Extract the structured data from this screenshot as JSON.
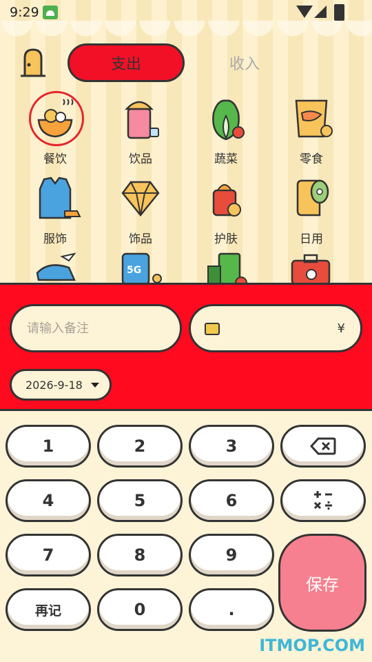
{
  "status_bar": {
    "time": "9:29"
  },
  "header": {
    "tab_expense": "支出",
    "tab_income": "收入"
  },
  "categories": [
    {
      "label": "餐饮",
      "icon": "food-bowl-icon",
      "selected": true
    },
    {
      "label": "饮品",
      "icon": "drink-icon"
    },
    {
      "label": "蔬菜",
      "icon": "vegetable-icon"
    },
    {
      "label": "零食",
      "icon": "snack-icon"
    },
    {
      "label": "服饰",
      "icon": "clothes-icon"
    },
    {
      "label": "饰品",
      "icon": "diamond-icon"
    },
    {
      "label": "护肤",
      "icon": "skincare-icon"
    },
    {
      "label": "日用",
      "icon": "tissue-icon"
    }
  ],
  "panel": {
    "note_placeholder": "请输入备注",
    "currency": "¥",
    "date": "2026-9-18"
  },
  "keypad": {
    "k1": "1",
    "k2": "2",
    "k3": "3",
    "k4": "4",
    "k5": "5",
    "k6": "6",
    "k7": "7",
    "k8": "8",
    "k9": "9",
    "k0": "0",
    "dot": ".",
    "again": "再记",
    "save": "保存"
  },
  "watermark": "ITMOP.COM",
  "colors": {
    "accent_red": "#f21027",
    "save_pink": "#f6808f",
    "cream": "#fdf3d6"
  }
}
